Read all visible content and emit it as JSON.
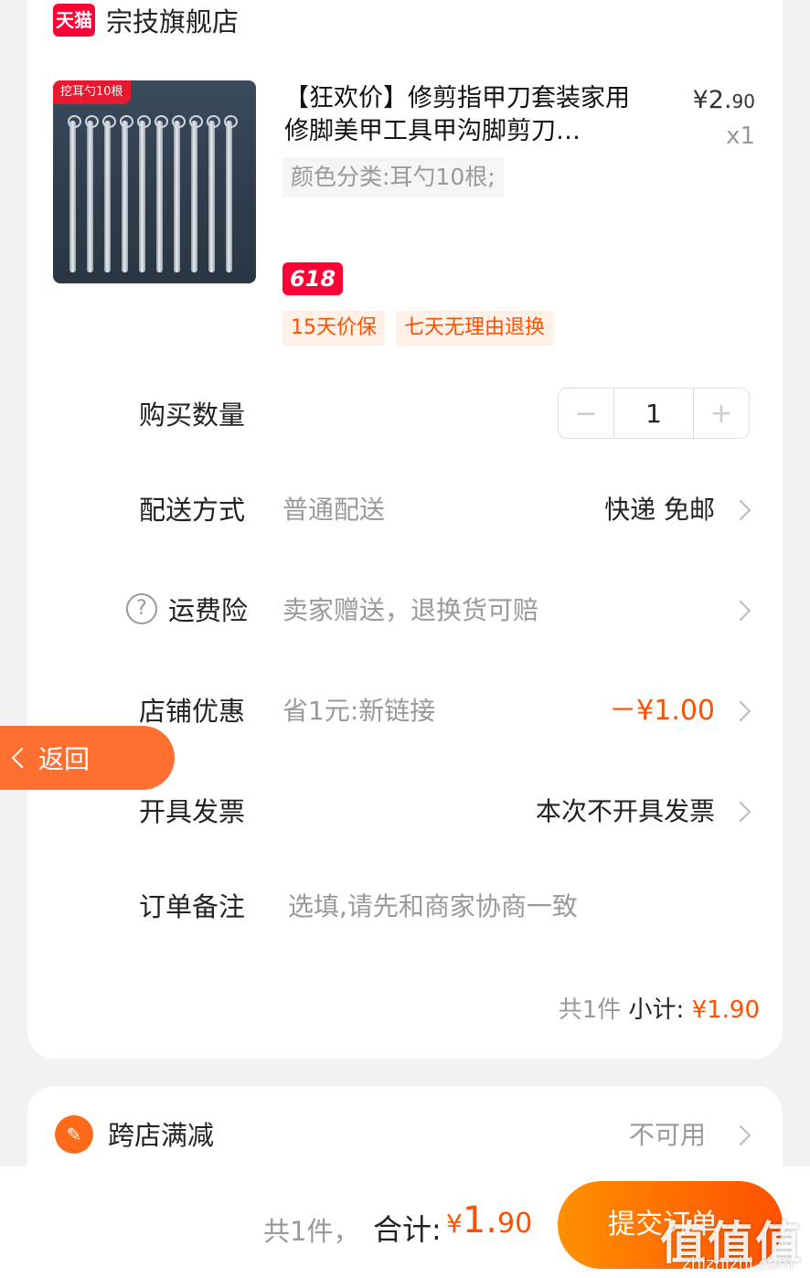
{
  "store": {
    "logo_text": "天猫",
    "name": "宗技旗舰店"
  },
  "product": {
    "image_tag": "挖耳勺10根",
    "title": "【狂欢价】修剪指甲刀套装家用修脚美甲工具甲沟脚剪刀…",
    "price_symbol": "¥",
    "price_int": "2.",
    "price_dec": "90",
    "quantity_x": "x1",
    "sku": "颜色分类:耳勺10根;",
    "badge": "618",
    "tags": [
      "15天价保",
      "七天无理由退换"
    ]
  },
  "rows": {
    "quantity": {
      "label": "购买数量",
      "value": "1",
      "minus": "−",
      "plus": "+"
    },
    "delivery": {
      "label": "配送方式",
      "value": "普通配送",
      "right": "快递 免邮"
    },
    "insurance": {
      "label": "运费险",
      "value": "卖家赠送，退换货可赔",
      "icon": "?"
    },
    "discount": {
      "label": "店铺优惠",
      "value": "省1元:新链接",
      "right": "－¥1.00"
    },
    "invoice": {
      "label": "开具发票",
      "right": "本次不开具发票"
    },
    "note": {
      "label": "订单备注",
      "placeholder": "选填,请先和商家协商一致"
    }
  },
  "subtotal": {
    "count": "共1件",
    "label": "小计:",
    "symbol": "¥",
    "amount": "1.90"
  },
  "back_button": {
    "label": "返回"
  },
  "promo": {
    "label": "跨店满减",
    "status": "不可用"
  },
  "bottom_bar": {
    "count": "共1件，",
    "total_label": "合计:",
    "symbol": "¥",
    "total_int": "1.",
    "total_dec": "90",
    "submit_label": "提交订单"
  },
  "watermark": {
    "text": "值值值",
    "url": "zhizhizhi.com"
  },
  "colors": {
    "accent": "#ff5000",
    "tmall_red": "#ff0036",
    "back_button": "#ff7030"
  }
}
